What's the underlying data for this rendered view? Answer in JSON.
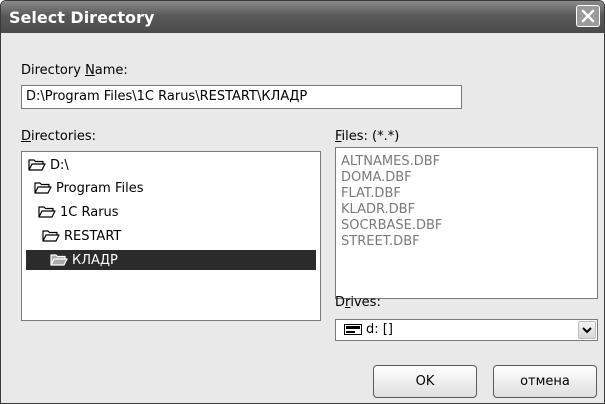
{
  "window": {
    "title": "Select Directory",
    "close_icon": "close-icon"
  },
  "directory_name": {
    "label_prefix": "Directory ",
    "label_accel": "N",
    "label_suffix": "ame:",
    "value": "D:\\Program Files\\1C Rarus\\RESTART\\КЛАДР"
  },
  "directories": {
    "label_accel": "D",
    "label_rest": "irectories:",
    "items": [
      {
        "label": "D:\\",
        "icon": "open-folder-icon",
        "selected": false
      },
      {
        "label": "Program Files",
        "icon": "open-folder-icon",
        "selected": false
      },
      {
        "label": "1C Rarus",
        "icon": "open-folder-icon",
        "selected": false
      },
      {
        "label": "RESTART",
        "icon": "open-folder-icon",
        "selected": false
      },
      {
        "label": "КЛАДР",
        "icon": "open-folder-icon",
        "selected": true
      }
    ]
  },
  "files": {
    "label_accel": "F",
    "label_rest": "iles: (*.*)",
    "items": [
      "ALTNAMES.DBF",
      "DOMA.DBF",
      "FLAT.DBF",
      "KLADR.DBF",
      "SOCRBASE.DBF",
      "STREET.DBF"
    ]
  },
  "drives": {
    "label_prefix": "D",
    "label_accel": "r",
    "label_suffix": "ives:",
    "selected": "d: []",
    "icon": "drive-icon"
  },
  "buttons": {
    "ok": "OK",
    "cancel": "отмена"
  }
}
